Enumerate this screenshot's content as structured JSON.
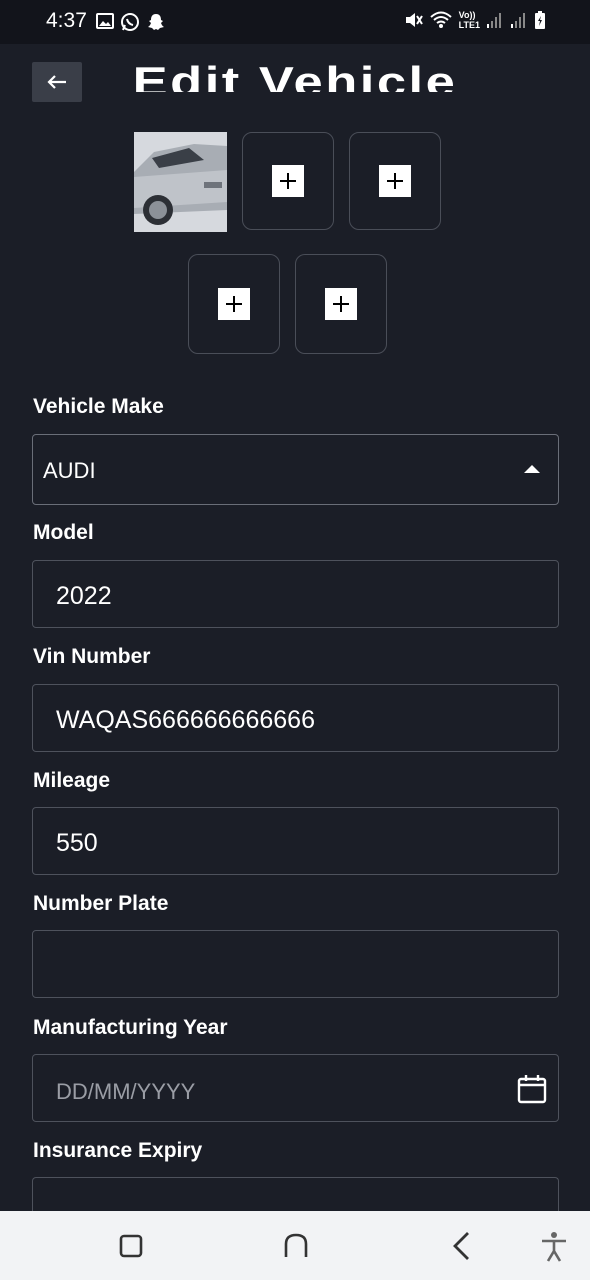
{
  "status_bar": {
    "time": "4:37",
    "left_icons": [
      "image-icon",
      "whatsapp-icon",
      "snapchat-icon"
    ],
    "right_icons": [
      "mute-icon",
      "wifi-icon",
      "volte-icon",
      "signal-icon",
      "signal-icon",
      "battery-icon"
    ],
    "volte_text": "Vo))",
    "lte_text": "LTE1"
  },
  "header": {
    "title": "Edit Vehicle",
    "back_icon": "arrow-left-icon"
  },
  "images": {
    "add_icon": "plus-icon",
    "slot_count": 5,
    "first_slot_filled": true
  },
  "form": {
    "make": {
      "label": "Vehicle Make",
      "value": "AUDI"
    },
    "model": {
      "label": "Model",
      "value": "2022"
    },
    "vin": {
      "label": "Vin Number",
      "value": "WAQAS666666666666"
    },
    "mileage": {
      "label": "Mileage",
      "value": "550"
    },
    "plate": {
      "label": "Number Plate",
      "value": ""
    },
    "year": {
      "label": "Manufacturing Year",
      "placeholder": "DD/MM/YYYY"
    },
    "insurance": {
      "label": "Insurance Expiry"
    }
  },
  "colors": {
    "background": "#1b1e27",
    "field_border": "#4e525c",
    "text": "#ffffff",
    "placeholder": "#9a9da5",
    "nav_bar": "#f2f3f5"
  },
  "nav_bar": {
    "buttons": [
      "recents-icon",
      "home-icon",
      "back-icon",
      "accessibility-icon"
    ]
  }
}
